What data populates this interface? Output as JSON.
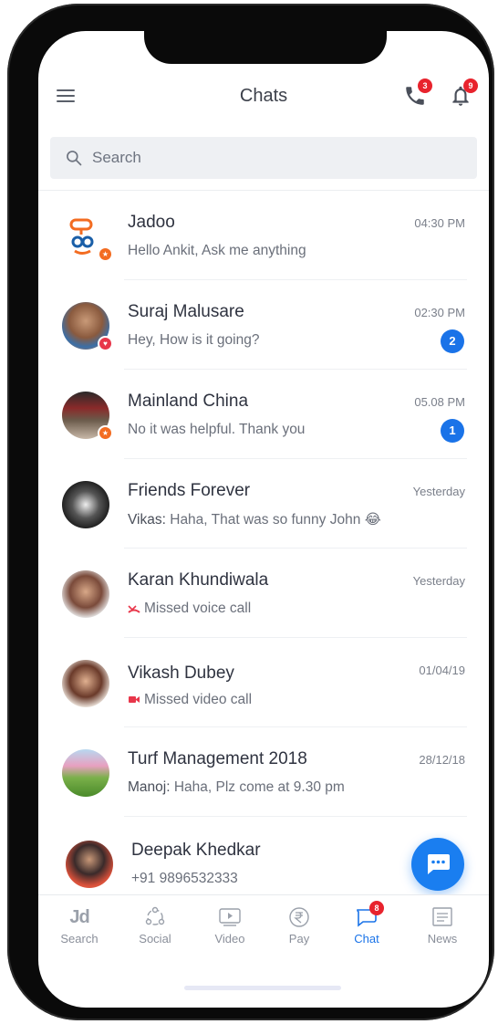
{
  "header": {
    "title": "Chats",
    "calls_badge": "3",
    "notifications_badge": "9"
  },
  "search": {
    "placeholder": "Search"
  },
  "chats": [
    {
      "name": "Jadoo",
      "message": "Hello Ankit, Ask me anything",
      "time": "04:30 PM"
    },
    {
      "name": "Suraj Malusare",
      "message": "Hey, How is it going?",
      "time": "02:30 PM",
      "unread": "2"
    },
    {
      "name": "Mainland China",
      "message": "No it was helpful. Thank you",
      "time": "05.08 PM",
      "unread": "1"
    },
    {
      "name": "Friends Forever",
      "sender": "Vikas:",
      "message": " Haha, That was so funny John 😂",
      "time": "Yesterday"
    },
    {
      "name": "Karan Khundiwala",
      "message": "Missed voice call",
      "time": "Yesterday"
    },
    {
      "name": "Vikash Dubey",
      "message": "Missed video call",
      "time": "01/04/19"
    },
    {
      "name": "Turf Management 2018",
      "sender": "Manoj:",
      "message": " Haha, Plz come at 9.30 pm",
      "time": "28/12/18"
    },
    {
      "name": "Deepak Khedkar",
      "message": "+91 9896532333"
    }
  ],
  "nav": {
    "items": [
      {
        "label": "Search",
        "logo": "Jd"
      },
      {
        "label": "Social"
      },
      {
        "label": "Video"
      },
      {
        "label": "Pay"
      },
      {
        "label": "Chat",
        "badge": "8"
      },
      {
        "label": "News"
      }
    ]
  },
  "colors": {
    "accent": "#1a73e8",
    "badge_red": "#e8232d",
    "orange": "#f36c21"
  },
  "icons": [
    "menu-icon",
    "phone-icon",
    "bell-icon",
    "search-icon",
    "missed-call-icon",
    "missed-video-icon",
    "chat-bubble-icon",
    "social-icon",
    "video-icon",
    "rupee-icon",
    "news-icon"
  ]
}
